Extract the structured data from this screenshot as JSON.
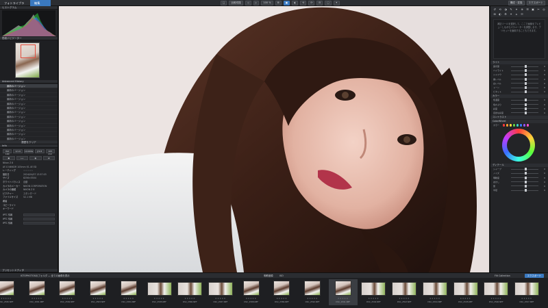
{
  "topbar": {
    "tab_library": "フォトライブラリ",
    "tab_edit": "編集",
    "center_buttons": [
      "□",
      "比較切換",
      "◁",
      "▷",
      "100 %",
      "⊞",
      "▣",
      "◐",
      "⟲",
      "⟳",
      "⊟",
      "▢",
      "✦"
    ],
    "right_buttons": [
      "構成・変換",
      "エクスポート"
    ]
  },
  "left": {
    "histogram_title": "ヒストグラム",
    "histogram_tabs": [
      "RGB",
      "R",
      "G",
      "B"
    ],
    "navigator_title": "簡易ナビゲーター",
    "navigator_zoom": "100",
    "history_title": "Advanced History",
    "history_items": [
      "最新のバージョン",
      "最新のバージョン",
      "最新のバージョン",
      "最新のバージョン",
      "最新のバージョン",
      "最新のバージョン",
      "最新のバージョン",
      "最新のバージョン",
      "最新のバージョン",
      "最新のバージョン",
      "最新のバージョン",
      "最新のバージョン",
      "最新のバージョン"
    ],
    "history_footer": "履歴をクリア",
    "info_title": "Info",
    "info_buttons": [
      "ISO 100",
      "1/1.6",
      "1/1000s",
      "ƒ/2.8",
      "105 mm"
    ],
    "camera_row": "Nikon Z 8",
    "lens_row": "AF-S NIKKOR 105mm f/1.4E ED",
    "info_rows": [
      {
        "k": "レーティング",
        "v": "☆☆☆☆☆"
      },
      {
        "k": "撮影日",
        "v": "2024/04/07 13:57:03"
      },
      {
        "k": "サイズ",
        "v": "8256×5504"
      },
      {
        "k": "ホワイトバランス",
        "v": "自動"
      },
      {
        "k": "カメラのメーカー",
        "v": "NIKON CORPORATION"
      },
      {
        "k": "カメラの機種",
        "v": "NIKON Z 8"
      },
      {
        "k": "ピクチャー",
        "v": "スタンダード"
      },
      {
        "k": "ファイルサイズ",
        "v": "52.1 MB"
      },
      {
        "k": "著者",
        "v": ""
      },
      {
        "k": "コピーライト",
        "v": ""
      },
      {
        "k": "キーワード",
        "v": ""
      }
    ],
    "iptc_rows": [
      "IPTC 情報",
      "IPTC 情報",
      "IPTC 情報"
    ],
    "bottom_title": "プリセットエディタ"
  },
  "right": {
    "tools": [
      "↺",
      "⟲",
      "◑",
      "✎",
      "⌖",
      "⊕",
      "☰",
      "▣",
      "✂",
      "◎",
      "⊞",
      "◐",
      "⚙",
      "✦",
      "⌂",
      "☷"
    ],
    "note": "補正ツールを選択して、ここで画像をプレビューしながらパラメーターを調整します。プリセットを適用することもできます。",
    "sections": [
      "ライト",
      "カラー",
      "コントラスト",
      "ディテール",
      "ColorWheel"
    ],
    "sliders_light": [
      {
        "k": "露光量",
        "v": "0"
      },
      {
        "k": "ハイライト",
        "v": "0"
      },
      {
        "k": "シャドウ",
        "v": "0"
      },
      {
        "k": "黒レベル",
        "v": "0"
      },
      {
        "k": "白レベル",
        "v": "0"
      },
      {
        "k": "トーン",
        "v": "0"
      },
      {
        "k": "ビネット",
        "v": "0"
      }
    ],
    "sliders_color": [
      {
        "k": "色温度",
        "v": "0"
      },
      {
        "k": "色かぶり",
        "v": "0"
      },
      {
        "k": "彩度",
        "v": "0"
      },
      {
        "k": "自然な彩度",
        "v": "0"
      }
    ],
    "sliders_detail": [
      {
        "k": "シャープ",
        "v": "0"
      },
      {
        "k": "ノイズ",
        "v": "0"
      },
      {
        "k": "明瞭度",
        "v": "0"
      },
      {
        "k": "ぼかし",
        "v": "0"
      },
      {
        "k": "量",
        "v": "0"
      },
      {
        "k": "半径",
        "v": "0"
      }
    ],
    "swatch_label": "カラー",
    "swatch_colors": [
      "#ff3b3b",
      "#ff9f2e",
      "#ffe13b",
      "#62d444",
      "#3bd4c4",
      "#3b7cff",
      "#9a52ff",
      "#ff52c8"
    ]
  },
  "filmstrip": {
    "left_text": "ISTOPHOTOSのフォルダ — 全ての画像を表示",
    "center_text": "明瞭度順",
    "filter_text": "ISO",
    "collection_text": "Filt Collection",
    "export_button": "エクスポート",
    "thumbs": [
      {
        "fn": "DSC_2580.NEF",
        "land": false,
        "sel": false
      },
      {
        "fn": "DSC_2581.NEF",
        "land": false,
        "sel": false
      },
      {
        "fn": "DSC_2582.NEF",
        "land": false,
        "sel": false
      },
      {
        "fn": "DSC_2583.NEF",
        "land": false,
        "sel": false
      },
      {
        "fn": "DSC_2584.NEF",
        "land": false,
        "sel": false
      },
      {
        "fn": "DSC_2585.NEF",
        "land": true,
        "sel": false
      },
      {
        "fn": "DSC_2586.NEF",
        "land": true,
        "sel": false
      },
      {
        "fn": "DSC_2587.NEF",
        "land": true,
        "sel": false
      },
      {
        "fn": "DSC_2588.NEF",
        "land": false,
        "sel": false
      },
      {
        "fn": "DSC_2589.NEF",
        "land": false,
        "sel": false
      },
      {
        "fn": "DSC_2590.NEF",
        "land": false,
        "sel": false
      },
      {
        "fn": "DSC_2591.NEF",
        "land": false,
        "sel": true
      },
      {
        "fn": "DSC_2592.NEF",
        "land": true,
        "sel": false
      },
      {
        "fn": "DSC_2593.NEF",
        "land": true,
        "sel": false
      },
      {
        "fn": "DSC_2594.NEF",
        "land": true,
        "sel": false
      },
      {
        "fn": "DSC_2595.NEF",
        "land": true,
        "sel": false
      },
      {
        "fn": "DSC_2596.NEF",
        "land": true,
        "sel": false
      },
      {
        "fn": "DSC_2597.NEF",
        "land": true,
        "sel": false
      }
    ],
    "stars": "★★★★★"
  },
  "colors": {
    "accent": "#3a79c0",
    "panel": "#232427",
    "bar": "#2b2d31"
  }
}
